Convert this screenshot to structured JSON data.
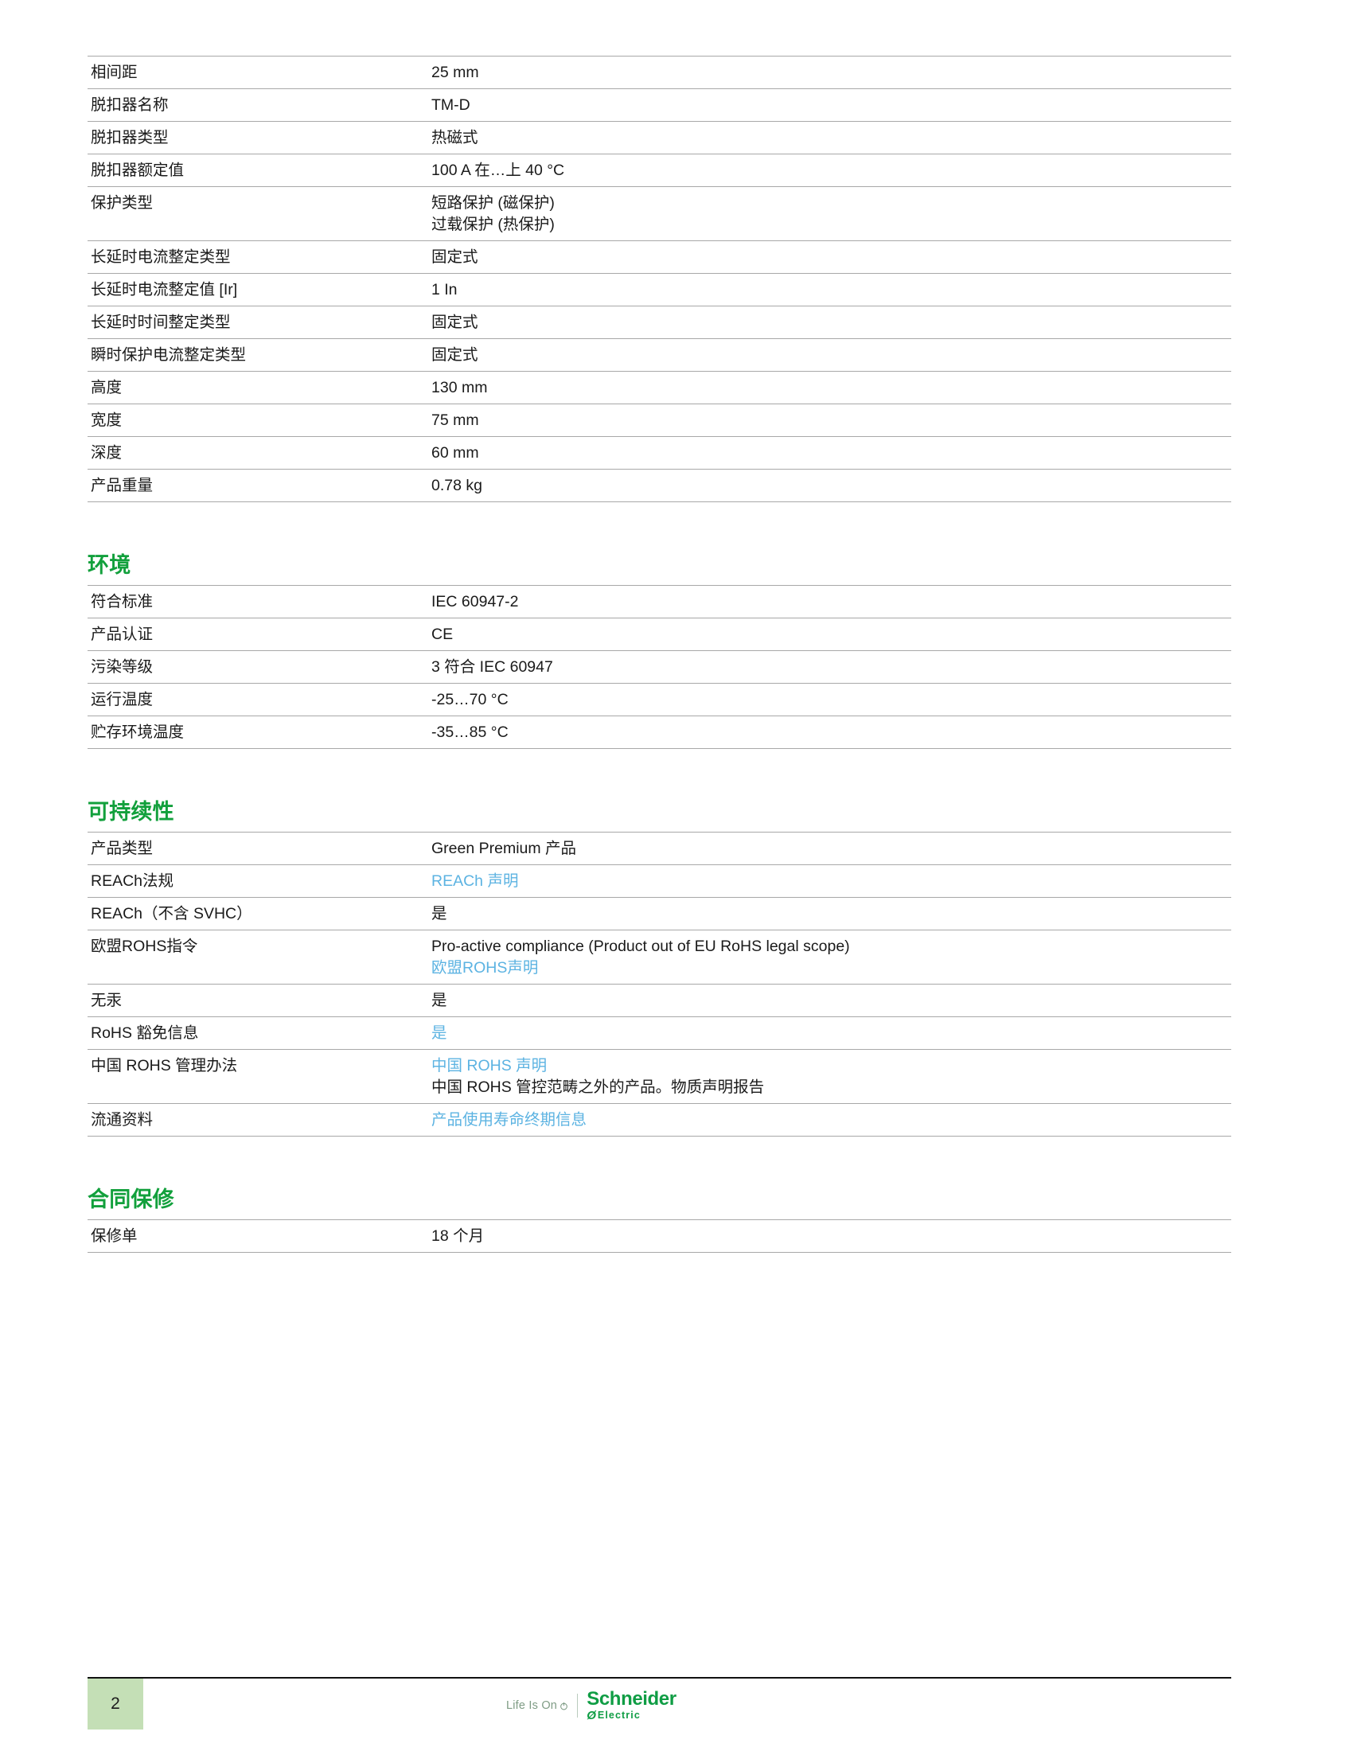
{
  "document": {
    "sections": [
      {
        "id": "specifications-continued",
        "heading": null,
        "rows": [
          {
            "key": "相间距",
            "values": [
              "25 mm"
            ]
          },
          {
            "key": "脱扣器名称",
            "values": [
              "TM-D"
            ]
          },
          {
            "key": "脱扣器类型",
            "values": [
              "热磁式"
            ]
          },
          {
            "key": "脱扣器额定值",
            "values": [
              "100 A 在…上 40 °C"
            ]
          },
          {
            "key": "保护类型",
            "values": [
              "短路保护 (磁保护)",
              "过载保护 (热保护)"
            ]
          },
          {
            "key": "长延时电流整定类型",
            "values": [
              "固定式"
            ]
          },
          {
            "key": "长延时电流整定值 [Ir]",
            "values": [
              "1 In"
            ]
          },
          {
            "key": "长延时时间整定类型",
            "values": [
              "固定式"
            ]
          },
          {
            "key": "瞬时保护电流整定类型",
            "values": [
              "固定式"
            ]
          },
          {
            "key": "高度",
            "values": [
              "130 mm"
            ]
          },
          {
            "key": "宽度",
            "values": [
              "75 mm"
            ]
          },
          {
            "key": "深度",
            "values": [
              "60 mm"
            ]
          },
          {
            "key": "产品重量",
            "values": [
              "0.78 kg"
            ]
          }
        ]
      },
      {
        "id": "environment",
        "heading": "环境",
        "rows": [
          {
            "key": "符合标准",
            "values": [
              "IEC 60947-2"
            ]
          },
          {
            "key": "产品认证",
            "values": [
              "CE"
            ]
          },
          {
            "key": "污染等级",
            "values": [
              "3 符合 IEC 60947"
            ]
          },
          {
            "key": "运行温度",
            "values": [
              "-25…70 °C"
            ]
          },
          {
            "key": "贮存环境温度",
            "values": [
              "-35…85 °C"
            ]
          }
        ]
      },
      {
        "id": "sustainability",
        "heading": "可持续性",
        "rows": [
          {
            "key": "产品类型",
            "values": [
              "Green Premium 产品"
            ]
          },
          {
            "key": "REACh法规",
            "values": [],
            "links": [
              "REACh 声明"
            ]
          },
          {
            "key": "REACh（不含 SVHC）",
            "values": [
              "是"
            ]
          },
          {
            "key": "欧盟ROHS指令",
            "values": [
              "Pro-active compliance (Product out of EU RoHS legal scope)"
            ],
            "links": [
              "欧盟ROHS声明"
            ]
          },
          {
            "key": "无汞",
            "values": [
              "是"
            ]
          },
          {
            "key": "RoHS 豁免信息",
            "values": [],
            "links": [
              "是"
            ]
          },
          {
            "key": "中国 ROHS 管理办法",
            "values": [
              "中国 ROHS 管控范畴之外的产品。物质声明报告"
            ],
            "links": [
              "中国 ROHS 声明"
            ],
            "link_first": true
          },
          {
            "key": "流通资料",
            "values": [],
            "links": [
              "产品使用寿命终期信息"
            ]
          }
        ]
      },
      {
        "id": "contractual-warranty",
        "heading": "合同保修",
        "rows": [
          {
            "key": "保修单",
            "values": [
              "18 个月"
            ]
          }
        ]
      }
    ]
  },
  "footer": {
    "page_number": "2",
    "tagline": "Life Is On",
    "brand_name": "Schneider",
    "brand_sub": "Electric",
    "brand_glyph": "Ø"
  },
  "colors": {
    "heading_green": "#12a03c",
    "link_blue": "#5cb3e2",
    "page_box_green": "#c4dfb6",
    "brand_green": "#0f9d44",
    "tagline_gray": "#7f9c85",
    "rule_light": "#a8a8a8",
    "rule_dark": "#1c1c1c"
  }
}
